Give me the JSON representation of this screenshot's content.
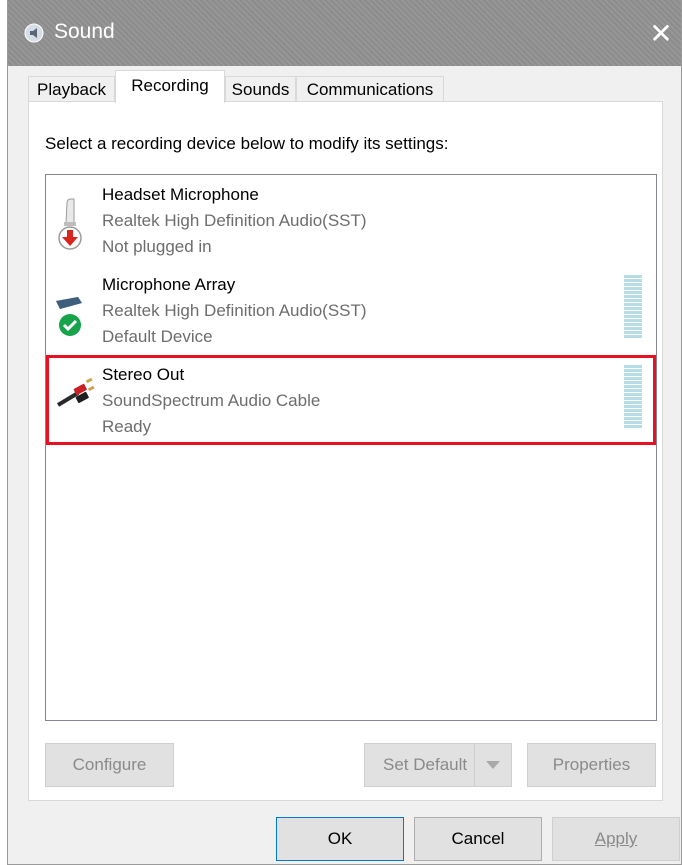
{
  "window": {
    "title": "Sound",
    "close_glyph": "✕"
  },
  "tabs": [
    {
      "label": "Playback",
      "active": false
    },
    {
      "label": "Recording",
      "active": true
    },
    {
      "label": "Sounds",
      "active": false
    },
    {
      "label": "Communications",
      "active": false
    }
  ],
  "panel": {
    "instruction": "Select a recording device below to modify its settings:"
  },
  "devices": [
    {
      "name": "Headset Microphone",
      "driver": "Realtek High Definition Audio(SST)",
      "status": "Not plugged in",
      "icon": "headset-microphone-icon",
      "status_icon": "unplugged-arrow-icon",
      "selected": false
    },
    {
      "name": "Microphone Array",
      "driver": "Realtek High Definition Audio(SST)",
      "status": "Default Device",
      "icon": "microphone-array-icon",
      "status_icon": "default-check-icon",
      "selected": false
    },
    {
      "name": "Stereo Out",
      "driver": "SoundSpectrum Audio Cable",
      "status": "Ready",
      "icon": "rca-cable-icon",
      "status_icon": "",
      "selected": true
    }
  ],
  "buttons": {
    "configure": "Configure",
    "set_default": "Set Default",
    "properties": "Properties",
    "ok": "OK",
    "cancel": "Cancel",
    "apply": "Apply"
  },
  "colors": {
    "titlebar": "#919191",
    "selection_outline": "#e81123",
    "meter": "#b6dde5",
    "ok_focus": "#0078d7",
    "default_check": "#16a34a",
    "unplugged_arrow": "#d9251d"
  }
}
